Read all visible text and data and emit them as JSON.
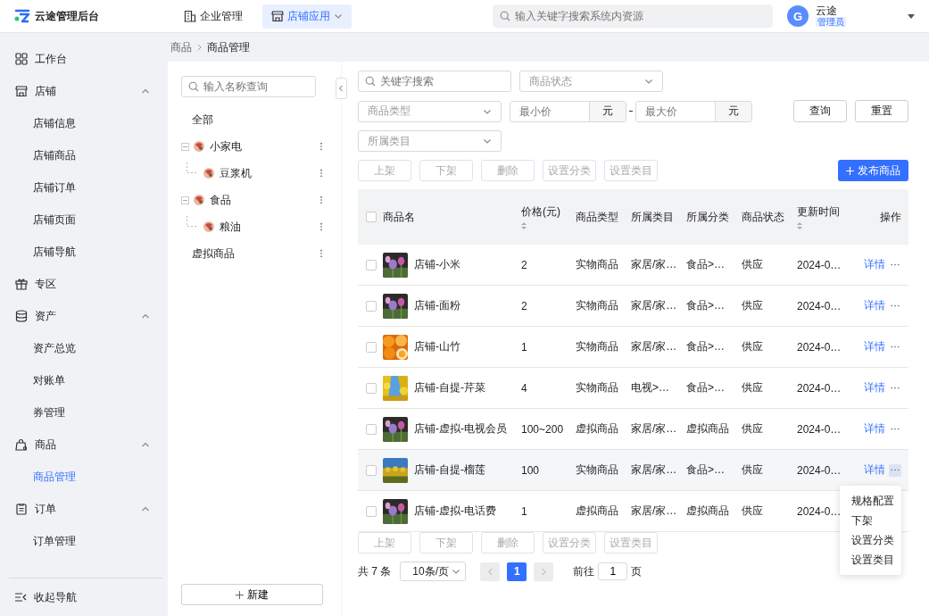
{
  "header": {
    "logo": "云途管理后台",
    "nav": [
      {
        "label": "企业管理",
        "selected": false,
        "dropdown": false
      },
      {
        "label": "店铺应用",
        "selected": true,
        "dropdown": true
      }
    ],
    "search": {
      "placeholder": "输入关键字搜索系统内资源"
    },
    "user": {
      "avatar": "G",
      "name": "云途",
      "role": "管理员"
    }
  },
  "sidebar": {
    "items": [
      {
        "label": "工作台",
        "selected": false
      },
      {
        "label": "店铺",
        "expanded": true,
        "selected": false,
        "children": [
          {
            "label": "店铺信息",
            "selected": false
          },
          {
            "label": "店铺商品",
            "selected": false
          },
          {
            "label": "店铺订单",
            "selected": false
          },
          {
            "label": "店铺页面",
            "selected": false
          },
          {
            "label": "店铺导航",
            "selected": false
          }
        ]
      },
      {
        "label": "专区",
        "selected": false
      },
      {
        "label": "资产",
        "expanded": true,
        "selected": false,
        "children": [
          {
            "label": "资产总览",
            "selected": false
          },
          {
            "label": "对账单",
            "selected": false
          },
          {
            "label": "券管理",
            "selected": false
          }
        ]
      },
      {
        "label": "商品",
        "expanded": true,
        "selected": false,
        "children": [
          {
            "label": "商品管理",
            "selected": true
          }
        ]
      },
      {
        "label": "订单",
        "expanded": true,
        "selected": false,
        "children": [
          {
            "label": "订单管理",
            "selected": false
          }
        ]
      }
    ],
    "collapse": "收起导航"
  },
  "breadcrumb": [
    "商品",
    "商品管理"
  ],
  "tree": {
    "search": {
      "placeholder": "输入名称查询"
    },
    "nodes": [
      {
        "label": "全部",
        "menu": false,
        "avatar": false
      },
      {
        "label": "小家电",
        "menu": true,
        "avatar": true,
        "expanded": true,
        "children": [
          {
            "label": "豆浆机",
            "menu": true,
            "avatar": true
          }
        ]
      },
      {
        "label": "食品",
        "menu": true,
        "avatar": true,
        "expanded": true,
        "children": [
          {
            "label": "粮油",
            "menu": true,
            "avatar": true
          }
        ]
      },
      {
        "label": "虚拟商品",
        "menu": true,
        "avatar": false
      }
    ],
    "new_button": "新建"
  },
  "filters": {
    "keyword": {
      "placeholder": "关键字搜索"
    },
    "status": {
      "placeholder": "商品状态"
    },
    "type": {
      "placeholder": "商品类型"
    },
    "min_price": {
      "placeholder": "最小价",
      "unit": "元"
    },
    "max_price": {
      "placeholder": "最大价",
      "unit": "元"
    },
    "category": {
      "placeholder": "所属类目"
    },
    "query_button": "查询",
    "reset_button": "重置"
  },
  "batch_actions_top": [
    {
      "label": "上架",
      "disabled": true
    },
    {
      "label": "下架",
      "disabled": true
    },
    {
      "label": "删除",
      "disabled": true
    },
    {
      "label": "设置分类",
      "disabled": true
    },
    {
      "label": "设置类目",
      "disabled": true
    }
  ],
  "publish_button": "发布商品",
  "table": {
    "all_checked": false,
    "columns": [
      {
        "label": "商品名",
        "sortable": false
      },
      {
        "label": "价格(元)",
        "sortable": true
      },
      {
        "label": "商品类型",
        "sortable": false
      },
      {
        "label": "所属类目",
        "sortable": false
      },
      {
        "label": "所属分类",
        "sortable": false
      },
      {
        "label": "商品状态",
        "sortable": false
      },
      {
        "label": "更新时间",
        "sortable": true
      },
      {
        "label": "操作",
        "sortable": false
      }
    ],
    "rows": [
      {
        "name": "店铺-小米",
        "price": "2",
        "type": "实物商品",
        "category": "家居/家…",
        "classification": "食品>…",
        "status": "供应",
        "updated": "2024-0…",
        "detail": "详情",
        "highlighted": false,
        "checked": false
      },
      {
        "name": "店铺-面粉",
        "price": "2",
        "type": "实物商品",
        "category": "家居/家…",
        "classification": "食品>…",
        "status": "供应",
        "updated": "2024-0…",
        "detail": "详情",
        "highlighted": false,
        "checked": false
      },
      {
        "name": "店铺-山竹",
        "price": "1",
        "type": "实物商品",
        "category": "家居/家…",
        "classification": "食品>…",
        "status": "供应",
        "updated": "2024-0…",
        "detail": "详情",
        "highlighted": false,
        "checked": false
      },
      {
        "name": "店铺-自提-芹菜",
        "price": "4",
        "type": "实物商品",
        "category": "电视>…",
        "classification": "食品>…",
        "status": "供应",
        "updated": "2024-0…",
        "detail": "详情",
        "highlighted": false,
        "checked": false
      },
      {
        "name": "店铺-虚拟-电视会员",
        "price": "100~200",
        "type": "虚拟商品",
        "category": "家居/家…",
        "classification": "虚拟商品",
        "status": "供应",
        "updated": "2024-0…",
        "detail": "详情",
        "highlighted": false,
        "checked": false
      },
      {
        "name": "店铺-自提-榴莲",
        "price": "100",
        "type": "实物商品",
        "category": "家居/家…",
        "classification": "食品>…",
        "status": "供应",
        "updated": "2024-0…",
        "detail": "详情",
        "highlighted": true,
        "checked": false
      },
      {
        "name": "店铺-虚拟-电话费",
        "price": "1",
        "type": "虚拟商品",
        "category": "家居/家…",
        "classification": "虚拟商品",
        "status": "供应",
        "updated": "2024-0…",
        "highlighted": false,
        "checked": false
      }
    ]
  },
  "action_menu": [
    "规格配置",
    "下架",
    "设置分类",
    "设置类目"
  ],
  "batch_actions_bottom": [
    {
      "label": "上架",
      "disabled": true
    },
    {
      "label": "下架",
      "disabled": true
    },
    {
      "label": "删除",
      "disabled": true
    },
    {
      "label": "设置分类",
      "disabled": true
    },
    {
      "label": "设置类目",
      "disabled": true
    }
  ],
  "pagination": {
    "total": "共 7 条",
    "page_size": "10条/页",
    "prev_disabled": true,
    "next_disabled": true,
    "pages": [
      {
        "label": "1",
        "selected": true
      }
    ],
    "goto_label": "前往",
    "goto_value": "1",
    "goto_suffix": "页"
  }
}
